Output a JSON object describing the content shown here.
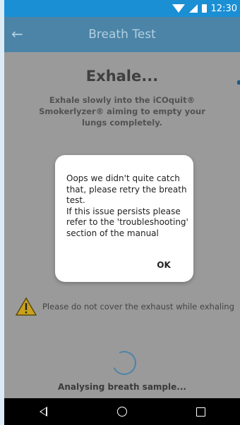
{
  "status_bar": {
    "time": "12:30",
    "icons": [
      "wifi-icon",
      "signal-icon",
      "battery-icon"
    ],
    "color": "#1a8fd4"
  },
  "app_bar": {
    "title": "Breath Test",
    "back_icon": "arrow-left-icon",
    "color": "#4b84a7"
  },
  "screen": {
    "heading": "Exhale...",
    "instructions": "Exhale slowly into the iCOquit® Smokerlyzer® aiming to empty your lungs completely.",
    "warning": {
      "icon": "warning-triangle-icon",
      "text": "Please do not cover the exhaust while exhaling"
    },
    "status": "Analysing breath sample..."
  },
  "dialog": {
    "lines": [
      "Oops we didn't quite catch",
      "that, please retry the breath",
      "test.",
      "If this issue persists please",
      "refer to the 'troubleshooting'",
      "section of the manual"
    ],
    "ok_label": "OK"
  },
  "nav_bar": {
    "buttons": [
      "back-nav-icon",
      "home-nav-icon",
      "recents-nav-icon"
    ]
  }
}
